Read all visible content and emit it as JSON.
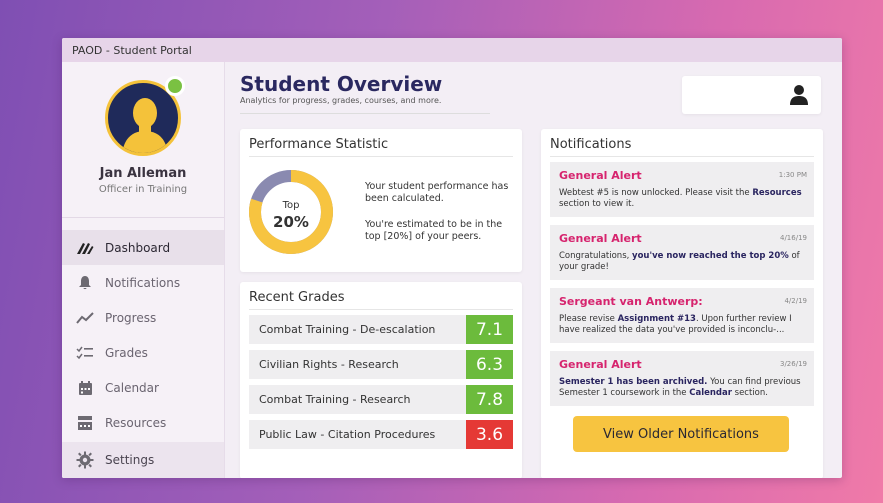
{
  "window": {
    "title": "PAOD - Student Portal"
  },
  "user": {
    "name": "Jan Alleman",
    "role": "Officer in Training"
  },
  "sidebar": {
    "items": [
      {
        "label": "Dashboard",
        "icon": "dashboard-logo-icon",
        "active": true
      },
      {
        "label": "Notifications",
        "icon": "bell-icon",
        "active": false
      },
      {
        "label": "Progress",
        "icon": "trend-line-icon",
        "active": false
      },
      {
        "label": "Grades",
        "icon": "checklist-icon",
        "active": false
      },
      {
        "label": "Calendar",
        "icon": "calendar-icon",
        "active": false
      },
      {
        "label": "Resources",
        "icon": "resources-icon",
        "active": false
      }
    ],
    "settings_label": "Settings"
  },
  "header": {
    "title": "Student Overview",
    "subtitle": "Analytics for progress, grades, courses, and more."
  },
  "performance": {
    "title": "Performance Statistic",
    "ring_top": "Top",
    "ring_value": "20%",
    "ring_fill": 0.8,
    "text1": "Your student performance has been calculated.",
    "text2": "You're estimated to be in the top [20%] of your peers."
  },
  "grades": {
    "title": "Recent Grades",
    "rows": [
      {
        "course": "Combat Training",
        "sep": " - ",
        "type": "De-escalation",
        "value": "7.1",
        "status": "good"
      },
      {
        "course": "Civilian Rights",
        "sep": " - ",
        "type": "Research",
        "value": "6.3",
        "status": "good"
      },
      {
        "course": "Combat Training",
        "sep": " - ",
        "type": "Research",
        "value": "7.8",
        "status": "good"
      },
      {
        "course": "Public Law",
        "sep": " - ",
        "type": "Citation Procedures",
        "value": "3.6",
        "status": "bad"
      }
    ]
  },
  "notifications": {
    "title": "Notifications",
    "items": [
      {
        "title": "General Alert",
        "time": "1:30 PM",
        "body_a": "Webtest #5 is now unlocked. Please visit the ",
        "body_b": "Resources",
        "body_c": " section to view it."
      },
      {
        "title": "General Alert",
        "time": "4/16/19",
        "body_a": "Congratulations, ",
        "body_b": "you've now reached the top 20%",
        "body_c": " of your grade!"
      },
      {
        "title": "Sergeant van Antwerp:",
        "time": "4/2/19",
        "body_a": "Please revise ",
        "body_b": "Assignment #13",
        "body_c": ". Upon further review I have realized the data you've provided is inconclu-..."
      },
      {
        "title": "General Alert",
        "time": "3/26/19",
        "body_a": "",
        "body_b": "Semester 1 has been archived.",
        "body_c": " You can find previous Semester 1 coursework in the ",
        "body_d": "Calendar",
        "body_e": " section."
      }
    ],
    "older_button": "View Older Notifications"
  },
  "colors": {
    "accent_yellow": "#f7c440",
    "alert_pink": "#d6246e",
    "grade_good": "#6cbb3c",
    "grade_bad": "#e53935",
    "ring_track": "#8a8ab0",
    "online": "#7ac142"
  }
}
